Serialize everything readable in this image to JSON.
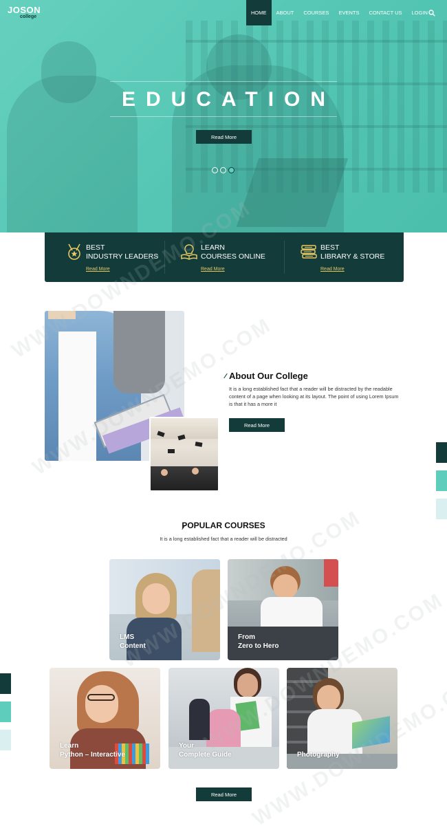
{
  "brand": {
    "name": "JOSON",
    "sub": "college"
  },
  "nav": {
    "items": [
      "HOME",
      "ABOUT",
      "COURSES",
      "EVENTS",
      "CONTACT US",
      "LOGIN"
    ],
    "active": "HOME"
  },
  "hero": {
    "title": "EDUCATION",
    "button": "Read More",
    "slides": 3,
    "active_slide": 3
  },
  "features": [
    {
      "icon": "medal-icon",
      "line1": "BEST",
      "line2": "INDUSTRY LEADERS",
      "link": "Read More"
    },
    {
      "icon": "lightbulb-book-icon",
      "line1": "LEARN",
      "line2": "COURSES ONLINE",
      "link": "Read More"
    },
    {
      "icon": "books-stack-icon",
      "line1": "BEST",
      "line2": "LIBRARY & STORE",
      "link": "Read More"
    }
  ],
  "about": {
    "title": "About Our College",
    "text": "It is a long established fact that a reader will be distracted by the readable content of a page when looking at its layout. The point of using Lorem Ipsum is that it has a more it",
    "button": "Read More"
  },
  "courses": {
    "title": "POPULAR COURSES",
    "subtitle": "It is a long established fact that a reader will be distracted",
    "cards": [
      {
        "label": "LMS\nContent"
      },
      {
        "label": "From\nZero to Hero"
      },
      {
        "label": "Learn\nPython – Interactive"
      },
      {
        "label": "Your\nComplete Guide"
      },
      {
        "label": "Photography"
      }
    ],
    "button": "Read More"
  },
  "watermark": "WWW.DOWNDEMO.COM",
  "colors": {
    "teal": "#5ecdbb",
    "dark": "#123b39",
    "gold": "#e8c862",
    "light": "#d9eff0"
  }
}
